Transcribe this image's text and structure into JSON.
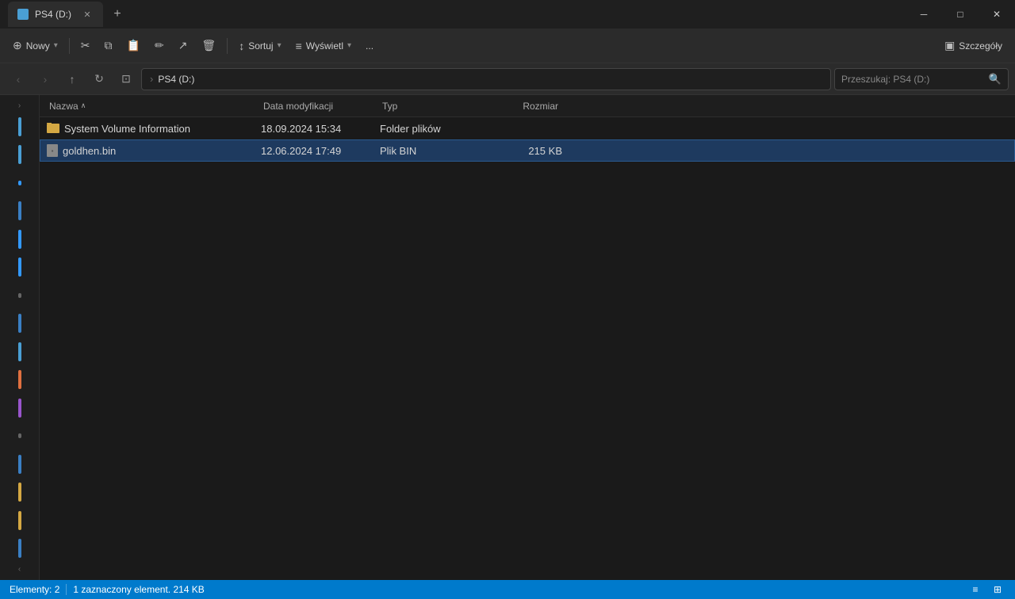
{
  "titleBar": {
    "tab": {
      "title": "PS4 (D:)",
      "icon": "folder-icon"
    },
    "newTabBtn": "+",
    "windowControls": {
      "minimize": "─",
      "maximize": "□",
      "close": "✕"
    }
  },
  "toolbar": {
    "newLabel": "Nowy",
    "cutTitle": "Wytnij",
    "copyTitle": "Kopiuj",
    "pasteTitle": "Wklej",
    "renameTitle": "Zmień nazwę",
    "deleteTitle": "Usuń",
    "sortLabel": "Sortuj",
    "viewLabel": "Wyświetl",
    "moreLabel": "...",
    "detailsLabel": "Szczegóły"
  },
  "addressBar": {
    "backTitle": "Wstecz",
    "forwardTitle": "Naprzód",
    "upTitle": "W górę",
    "refreshTitle": "Odśwież",
    "currentPath": "PS4 (D:)",
    "searchPlaceholder": "Przeszukaj: PS4 (D:)"
  },
  "columns": {
    "name": "Nazwa",
    "date": "Data modyfikacji",
    "type": "Typ",
    "size": "Rozmiar",
    "sortArrow": "∧"
  },
  "files": [
    {
      "id": "f1",
      "name": "System Volume Information",
      "date": "18.09.2024 15:34",
      "type": "Folder plików",
      "size": "",
      "icon": "folder",
      "selected": false
    },
    {
      "id": "f2",
      "name": "goldhen.bin",
      "date": "12.06.2024 17:49",
      "type": "Plik BIN",
      "size": "215 KB",
      "icon": "bin",
      "selected": true
    }
  ],
  "statusBar": {
    "itemCount": "Elementy: 2",
    "selectedInfo": "1 zaznaczony element. 214 KB"
  },
  "sidebar": {
    "expandIcon": "›",
    "collapseIcon": "‹",
    "bars": [
      {
        "color": "#4a9fd4"
      },
      {
        "color": "#4a9fd4"
      },
      {
        "color": "#3a7fc4"
      },
      {
        "color": "#5555cc"
      },
      {
        "color": "#3399ff"
      },
      {
        "color": "#3399ff"
      },
      {
        "color": "#666"
      },
      {
        "color": "#3a7fc4"
      },
      {
        "color": "#4a9fd4"
      },
      {
        "color": "#e07040"
      },
      {
        "color": "#9955cc"
      },
      {
        "color": "#666"
      },
      {
        "color": "#3a7fc4"
      },
      {
        "color": "#d4a843"
      },
      {
        "color": "#d4a843"
      },
      {
        "color": "#3a7fc4"
      }
    ]
  }
}
